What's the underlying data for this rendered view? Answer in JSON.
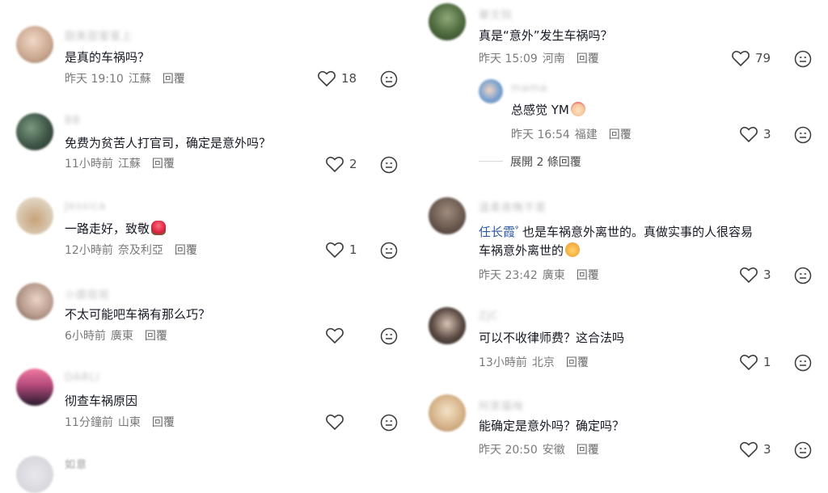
{
  "left": [
    {
      "username": "甜美甜蜜蜜上",
      "text": "是真的车祸吗？",
      "time": "昨天 19:10",
      "location": "江蘇",
      "reply": "回覆",
      "likes": "18"
    },
    {
      "username": "BB",
      "text": "免费为贫苦人打官司，确定是意外吗？",
      "time": "11小時前",
      "location": "江蘇",
      "reply": "回覆",
      "likes": "2"
    },
    {
      "username": "Jessica",
      "text": "一路走好，致敬",
      "emoji": "rose",
      "time": "12小時前",
      "location": "奈及利亞",
      "reply": "回覆",
      "likes": "1"
    },
    {
      "username": "小鹿斑斑",
      "text": "不太可能吧车祸有那么巧？",
      "time": "6小時前",
      "location": "廣東",
      "reply": "回覆",
      "likes": ""
    },
    {
      "username": "DARLI",
      "text": "彻查车祸原因",
      "time": "11分鐘前",
      "location": "山東",
      "reply": "回覆",
      "likes": ""
    },
    {
      "username": "如意",
      "text": "",
      "time": "",
      "location": "",
      "reply": "",
      "likes": ""
    }
  ],
  "right": {
    "top": {
      "username": "華文院",
      "text": "真是“意外”发生车祸吗？",
      "time": "昨天 15:09",
      "location": "河南",
      "reply": "回覆",
      "likes": "79"
    },
    "reply_item": {
      "username": "mama",
      "text": "总感觉 YM",
      "emoji": "clown",
      "time": "昨天 16:54",
      "location": "福建",
      "reply": "回覆",
      "likes": "3"
    },
    "expand_label": "展開 2 條回覆",
    "mention_comment": {
      "username": "温柔夜晚不是",
      "mention": "任长霞",
      "text": " 也是车祸意外离世的。真做实事的人很容易",
      "text2": "车祸意外离世的",
      "emoji": "face",
      "time": "昨天 23:42",
      "location": "廣東",
      "reply": "回覆",
      "likes": "3"
    },
    "c4": {
      "username": "ZJC",
      "text": "可以不收律师费？这合法吗",
      "time": "13小時前",
      "location": "北京",
      "reply": "回覆",
      "likes": "1"
    },
    "c5": {
      "username": "阿茶猫咪",
      "text": "能确定是意外吗？确定吗？",
      "time": "昨天 20:50",
      "location": "安徽",
      "reply": "回覆",
      "likes": "3"
    }
  },
  "colors": {
    "text": "#161823",
    "meta": "#7a7a7a",
    "mention": "#2b5a9e",
    "username_blur": "#c2c2c2"
  },
  "icons": {
    "like": "heart-outline-icon",
    "dislike": "dislike-face-icon",
    "mention_marker": "search-q-icon"
  }
}
